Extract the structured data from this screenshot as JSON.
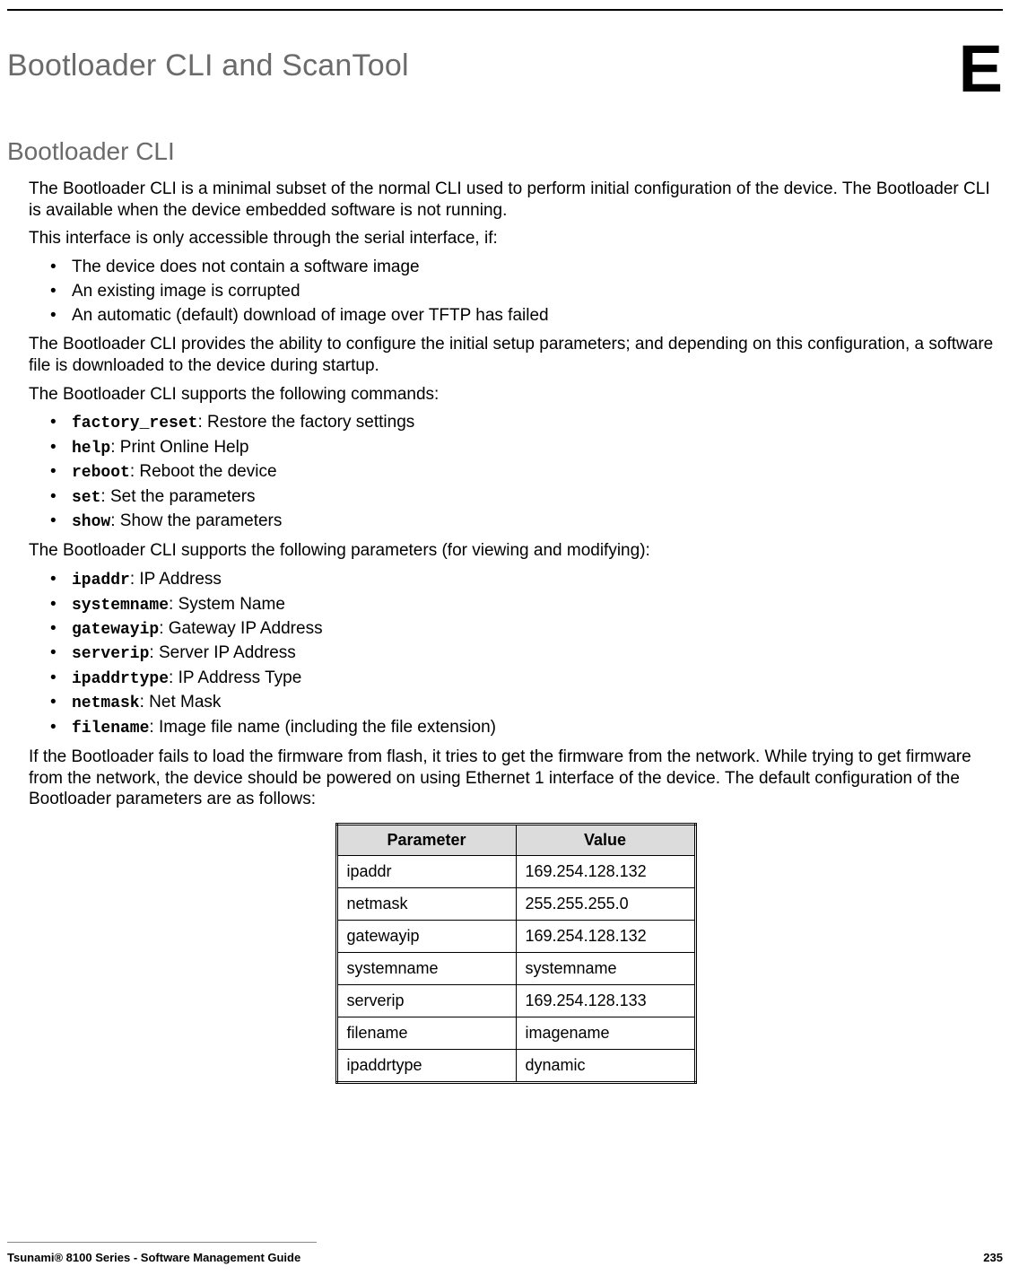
{
  "header": {
    "chapter_title": "Bootloader CLI and ScanTool",
    "chapter_letter": "E"
  },
  "section": {
    "title": "Bootloader CLI",
    "para1": "The Bootloader CLI is a minimal subset of the normal CLI used to perform initial configuration of the device. The Bootloader CLI is available when the device embedded software is not running.",
    "para2": "This interface is only accessible through the serial interface, if:",
    "conditions": [
      "The device does not contain a software image",
      "An existing image is corrupted",
      "An automatic (default) download of image over TFTP has failed"
    ],
    "para3": "The Bootloader CLI provides the ability to configure the initial setup parameters; and depending on this configuration, a software file is downloaded to the device during startup.",
    "para4": "The Bootloader CLI supports the following commands:",
    "commands": [
      {
        "name": "factory_reset",
        "desc": ": Restore the factory settings"
      },
      {
        "name": "help",
        "desc": ": Print Online Help"
      },
      {
        "name": "reboot",
        "desc": ": Reboot the device"
      },
      {
        "name": "set",
        "desc": ": Set the parameters"
      },
      {
        "name": "show",
        "desc": ": Show the parameters"
      }
    ],
    "para5": "The Bootloader CLI supports the following parameters (for viewing and modifying):",
    "parameters": [
      {
        "name": "ipaddr",
        "desc": ": IP Address"
      },
      {
        "name": "systemname",
        "desc": ": System Name"
      },
      {
        "name": "gatewayip",
        "desc": ": Gateway IP Address"
      },
      {
        "name": "serverip",
        "desc": ": Server IP Address"
      },
      {
        "name": "ipaddrtype",
        "desc": ": IP Address Type"
      },
      {
        "name": "netmask",
        "desc": ": Net Mask"
      },
      {
        "name": "filename",
        "desc": ": Image file name (including the file extension)"
      }
    ],
    "para6": "If the Bootloader fails to load the firmware from flash, it tries to get the firmware from the network. While trying to get firmware from the network, the device should be powered on using Ethernet 1 interface of the device. The default configuration of the Bootloader parameters are as follows:",
    "table": {
      "headers": [
        "Parameter",
        "Value"
      ],
      "rows": [
        {
          "param": "ipaddr",
          "value": "169.254.128.132"
        },
        {
          "param": "netmask",
          "value": "255.255.255.0"
        },
        {
          "param": "gatewayip",
          "value": "169.254.128.132"
        },
        {
          "param": "systemname",
          "value": "systemname"
        },
        {
          "param": "serverip",
          "value": "169.254.128.133"
        },
        {
          "param": "filename",
          "value": "imagename"
        },
        {
          "param": "ipaddrtype",
          "value": "dynamic"
        }
      ]
    }
  },
  "footer": {
    "left": "Tsunami® 8100 Series - Software Management Guide",
    "right": "235"
  }
}
